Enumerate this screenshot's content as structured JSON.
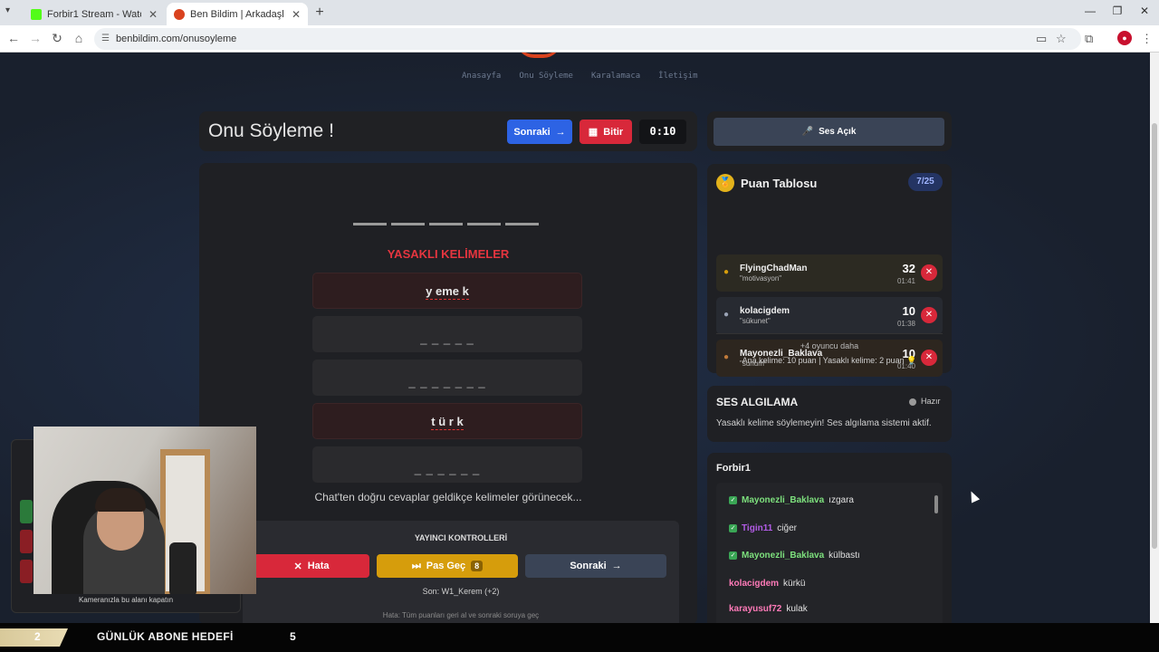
{
  "browser": {
    "tabs": [
      {
        "title": "Forbir1 Stream - Watch Live on",
        "favicon_color": "#53fc18",
        "active": false
      },
      {
        "title": "Ben Bildim | Arkadaşlarınla Onl",
        "favicon_color": "#d9421e",
        "active": true
      }
    ],
    "url": "benbildim.com/onusoyleme"
  },
  "site": {
    "nav": [
      "Anasayfa",
      "Onu Söyleme",
      "Karalamaca",
      "İletişim"
    ]
  },
  "game": {
    "title": "Onu Söyleme !",
    "next_label": "Sonraki",
    "finish_label": "Bitir",
    "timer": "0:10",
    "forbidden_title": "YASAKLI KELİMELER",
    "forbidden_words": [
      {
        "text": "y eme k",
        "revealed": true
      },
      {
        "text": "_ _ _ _ _",
        "revealed": false
      },
      {
        "text": "_ _ _ _ _ _ _",
        "revealed": false
      },
      {
        "text": "t ü r k",
        "revealed": true
      },
      {
        "text": "_ _ _ _ _ _",
        "revealed": false
      }
    ],
    "hint": "Chat'ten doğru cevaplar geldikçe kelimeler görünecek...",
    "controls": {
      "title": "YAYINCI KONTROLLERİ",
      "error_label": "Hata",
      "pass_label": "Pas Geç",
      "pass_count": "8",
      "next_label": "Sonraki",
      "last": "Son: W1_Kerem (+2)",
      "error_info": "Hata: Tüm puanları geri al ve sonraki soruya geç"
    }
  },
  "sound": {
    "label": "Ses Açık"
  },
  "scoreboard": {
    "title": "Puan Tablosu",
    "count": "7/25",
    "rows": [
      {
        "name": "FlyingChadMan",
        "word": "\"motivasyon\"",
        "points": "32",
        "time": "01:41",
        "medal_color": "#d69d0c",
        "bg": "#2c2a22"
      },
      {
        "name": "kolacigdem",
        "word": "\"sükunet\"",
        "points": "10",
        "time": "01:38",
        "medal_color": "#9aa3b5",
        "bg": "#272a31"
      },
      {
        "name": "Mayonezli_Baklava",
        "word": "\"sunum\"",
        "points": "10",
        "time": "01:40",
        "medal_color": "#c07a3a",
        "bg": "#2d261f"
      }
    ],
    "more": "+4 oyuncu daha",
    "rules": "Ana kelime: 10 puan | Yasaklı kelime: 2 puan 💡"
  },
  "voice": {
    "title": "SES ALGILAMA",
    "status": "Hazır",
    "desc": "Yasaklı kelime söylemeyin! Ses algılama sistemi aktif."
  },
  "chat": {
    "title": "Forbir1",
    "messages": [
      {
        "user": "Mayonezli_Baklava",
        "text": "ızgara",
        "color": "#7de07d",
        "check": true
      },
      {
        "user": "Tigin11",
        "text": "ciğer",
        "color": "#b25ce6",
        "check": true
      },
      {
        "user": "Mayonezli_Baklava",
        "text": "külbastı",
        "color": "#7de07d",
        "check": true
      },
      {
        "user": "kolacigdem",
        "text": "kürkü",
        "color": "#ff7ab8",
        "check": false
      },
      {
        "user": "karayusuf72",
        "text": "kulak",
        "color": "#ff7ab8",
        "check": false
      }
    ]
  },
  "stream": {
    "cam_note": "Kameranızla bu alanı kapatın",
    "goal_title": "GÜNLÜK ABONE HEDEFİ",
    "goal_current": "2",
    "goal_target": "5"
  }
}
